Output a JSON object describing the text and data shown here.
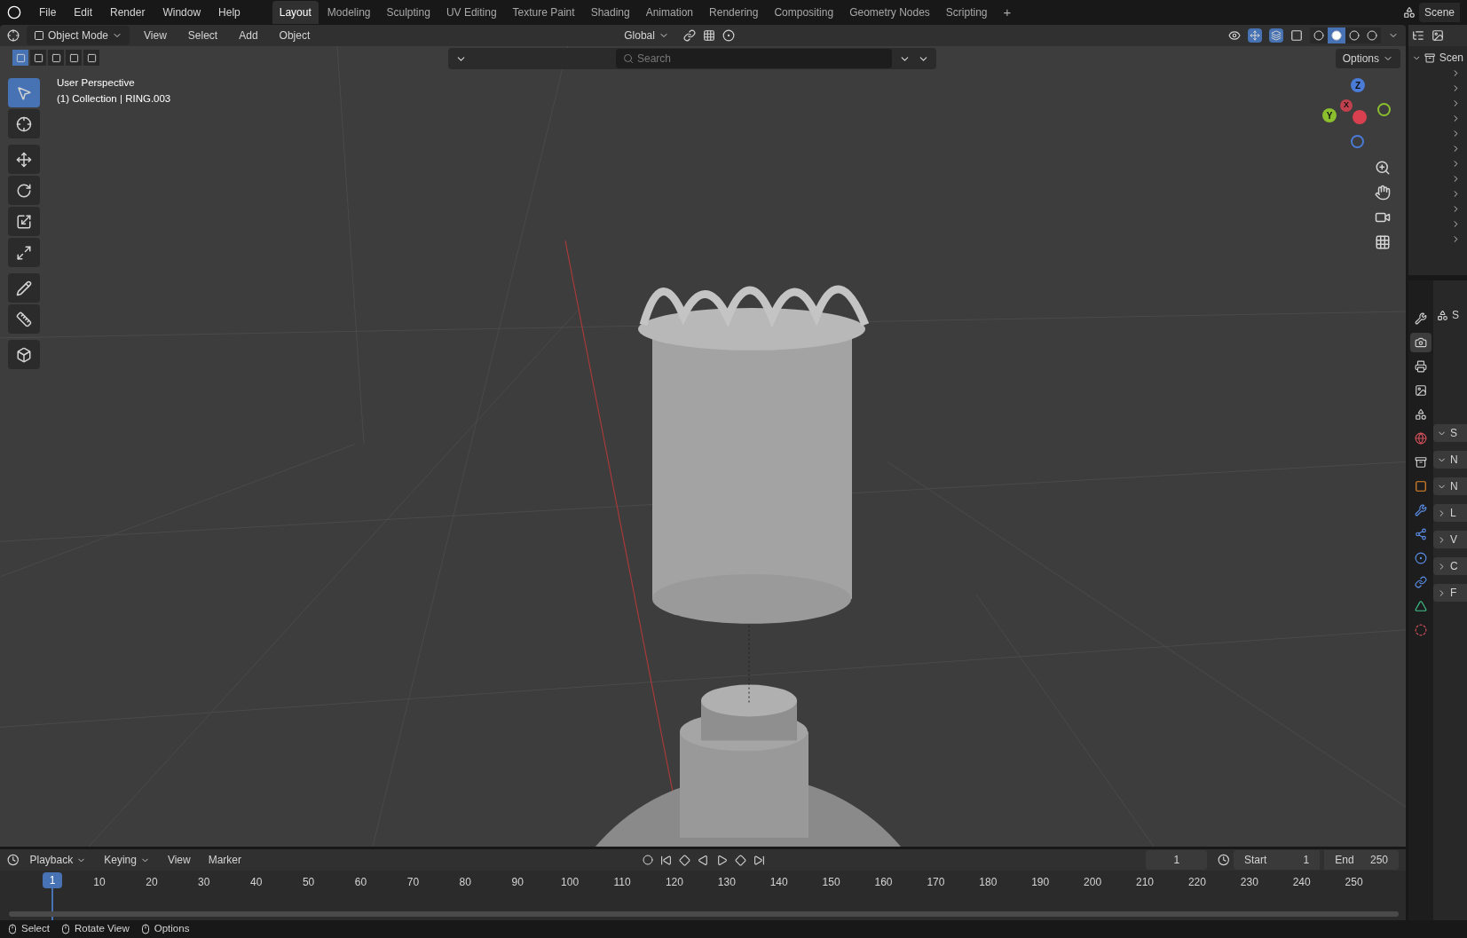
{
  "menu": [
    "File",
    "Edit",
    "Render",
    "Window",
    "Help"
  ],
  "workspaces": [
    {
      "label": "Layout",
      "selected": true
    },
    {
      "label": "Modeling",
      "selected": false
    },
    {
      "label": "Sculpting",
      "selected": false
    },
    {
      "label": "UV Editing",
      "selected": false
    },
    {
      "label": "Texture Paint",
      "selected": false
    },
    {
      "label": "Shading",
      "selected": false
    },
    {
      "label": "Animation",
      "selected": false
    },
    {
      "label": "Rendering",
      "selected": false
    },
    {
      "label": "Compositing",
      "selected": false
    },
    {
      "label": "Geometry Nodes",
      "selected": false
    },
    {
      "label": "Scripting",
      "selected": false
    }
  ],
  "add_workspace": "+",
  "scene_selector": "Scene",
  "viewport_header": {
    "mode": "Object Mode",
    "menus": [
      "View",
      "Select",
      "Add",
      "Object"
    ],
    "orientation": "Global",
    "search_placeholder": "Search",
    "options": "Options"
  },
  "select_modes": [
    {
      "selected": true
    },
    {
      "selected": false
    },
    {
      "selected": false
    },
    {
      "selected": false
    },
    {
      "selected": false
    }
  ],
  "shading_modes": [
    {
      "selected": false
    },
    {
      "selected": true
    },
    {
      "selected": false
    },
    {
      "selected": false
    }
  ],
  "viewport_info": {
    "view": "User Perspective",
    "object": "(1) Collection | RING.003"
  },
  "tools": [
    {
      "kind": "select",
      "selected": true
    },
    {
      "kind": "cursor",
      "selected": false
    },
    {
      "kind": "move",
      "selected": false
    },
    {
      "kind": "rotate",
      "selected": false
    },
    {
      "kind": "scale",
      "selected": false
    },
    {
      "kind": "transform",
      "selected": false
    },
    {
      "kind": "annotate",
      "selected": false
    },
    {
      "kind": "measure",
      "selected": false
    },
    {
      "kind": "add-cube",
      "selected": false
    }
  ],
  "gizmo": {
    "z": "Z",
    "y": "Y",
    "x": "X"
  },
  "outliner": {
    "scene": "Scen"
  },
  "properties": {
    "tabs": [
      {
        "kind": "tool",
        "selected": false
      },
      {
        "kind": "render",
        "selected": true
      },
      {
        "kind": "output",
        "selected": false
      },
      {
        "kind": "view-layer",
        "selected": false
      },
      {
        "kind": "scene",
        "selected": false
      },
      {
        "kind": "world",
        "selected": false
      },
      {
        "kind": "collection",
        "selected": false
      },
      {
        "kind": "object",
        "selected": false
      },
      {
        "kind": "modifier",
        "selected": false
      },
      {
        "kind": "particles",
        "selected": false
      },
      {
        "kind": "physics",
        "selected": false
      },
      {
        "kind": "constraints",
        "selected": false
      },
      {
        "kind": "data",
        "selected": false
      },
      {
        "kind": "material",
        "selected": false
      }
    ],
    "header": "S",
    "panels": [
      {
        "label": "S",
        "expanded": true
      },
      {
        "label": "N",
        "expanded": true
      },
      {
        "label": "N",
        "expanded": true
      },
      {
        "label": "L",
        "expanded": false
      },
      {
        "label": "V",
        "expanded": false
      },
      {
        "label": "C",
        "expanded": false
      },
      {
        "label": "F",
        "expanded": false
      }
    ]
  },
  "timeline": {
    "menus": [
      "Playback",
      "Keying",
      "View",
      "Marker"
    ],
    "frame": "1",
    "start_label": "Start",
    "start": "1",
    "end_label": "End",
    "end": "250",
    "current": "1",
    "ticks": [
      "10",
      "20",
      "30",
      "40",
      "50",
      "60",
      "70",
      "80",
      "90",
      "100",
      "110",
      "120",
      "130",
      "140",
      "150",
      "160",
      "170",
      "180",
      "190",
      "200",
      "210",
      "220",
      "230",
      "240",
      "250"
    ]
  },
  "status_bar": [
    "Select",
    "Rotate View",
    "Options"
  ]
}
